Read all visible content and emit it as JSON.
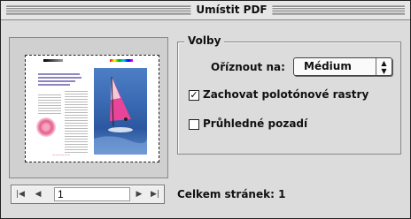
{
  "window": {
    "title": "Umístit PDF"
  },
  "options": {
    "group_label": "Volby",
    "crop_label": "Oříznout na:",
    "crop_value": "Médium",
    "halftone": {
      "label": "Zachovat polotónové rastry",
      "checked": true
    },
    "transparent": {
      "label": "Průhledné pozadí",
      "checked": false
    }
  },
  "pager": {
    "current_page": "1"
  },
  "total_pages_label": "Celkem stránek: 1",
  "icons": {
    "first": "first-page-icon",
    "prev": "previous-page-icon",
    "next": "next-page-icon",
    "last": "last-page-icon",
    "select_arrows": "up-down-arrows-icon",
    "checkmark": "checkmark-icon"
  },
  "colors": {
    "dialog_bg": "#dcdcdc",
    "preview_headline": "#7a6fb0",
    "preview_sea": "#3a6ab3",
    "preview_accent": "#e55d8a"
  }
}
